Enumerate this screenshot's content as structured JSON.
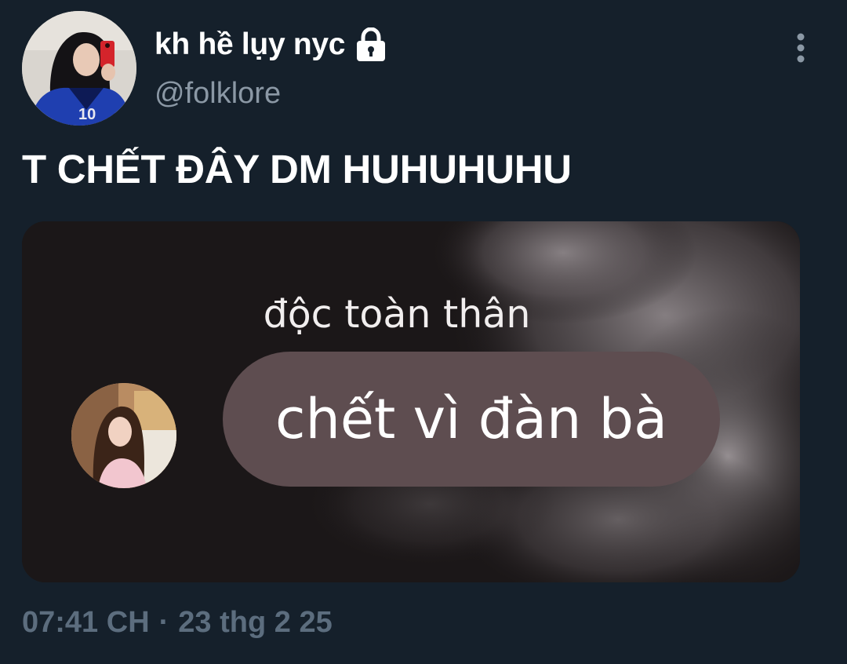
{
  "author": {
    "display_name": "kh hề lụy nyc",
    "username": "@folklore",
    "avatar": "profile-avatar",
    "protected_icon": "lock-icon"
  },
  "menu": {
    "icon": "more-vertical-icon"
  },
  "tweet": {
    "text": "T CHẾT ĐÂY DM HUHUHUHU"
  },
  "media": {
    "caption": "độc toàn thân",
    "bubble_text": "chết vì đàn bà",
    "small_avatar": "chat-avatar"
  },
  "meta": {
    "time": "07:41 CH",
    "separator": "·",
    "date": "23 thg 2 25"
  },
  "colors": {
    "background": "#15202b",
    "secondary_text": "#8b98a5",
    "timestamp_text": "#5c6d7e",
    "bubble": "#5e4d50"
  }
}
